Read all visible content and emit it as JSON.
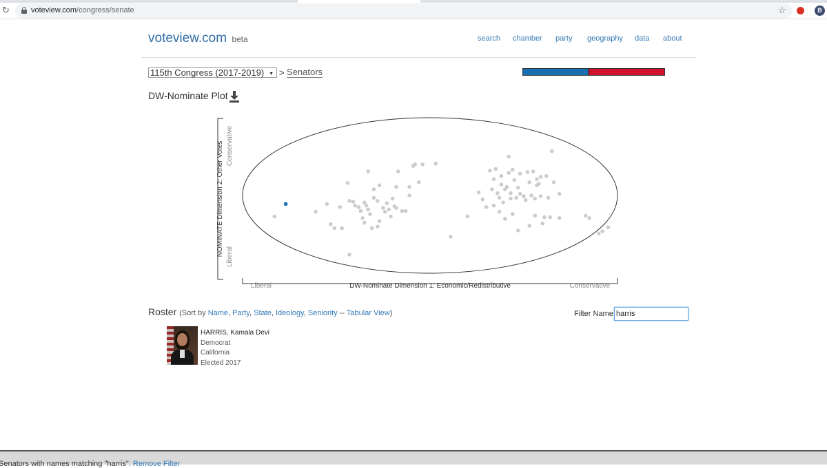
{
  "browser": {
    "url_host": "voteview.com",
    "url_path": "/congress/senate",
    "profile_initial": "B"
  },
  "site": {
    "brand": "voteview.com",
    "beta": "beta",
    "nav": [
      "search",
      "chamber",
      "party",
      "geography",
      "data",
      "about"
    ]
  },
  "congress": {
    "selected": "115th Congress (2017-2019)",
    "separator": ">",
    "chamber_link": "Senators"
  },
  "party_bar": {
    "dem_fraction": 0.46,
    "ind_fraction": 0.01,
    "rep_fraction": 0.53,
    "colors": {
      "dem": "#1a6fb0",
      "ind": "#333333",
      "rep": "#d0142c"
    }
  },
  "plot": {
    "title": "DW-Nominate Plot",
    "download_icon": "download-icon",
    "y_axis_label": "NOMINATE Dimension 2: Other Votes",
    "y_top_label": "Conservative",
    "y_bottom_label": "Liberal",
    "x_axis_label": "DW-Nominate Dimension 1: Economic/Redistributive",
    "x_left_label": "Liberal",
    "x_right_label": "Conservative"
  },
  "chart_data": {
    "type": "scatter",
    "title": "DW-Nominate Plot",
    "xlabel": "DW-Nominate Dimension 1: Economic/Redistributive",
    "ylabel": "NOMINATE Dimension 2: Other Votes",
    "xlim": [
      -1,
      1
    ],
    "ylim": [
      -1,
      1
    ],
    "highlight_color": "#1a6fb0",
    "point_color": "#cccccc",
    "highlighted": [
      {
        "x": -0.77,
        "y": -0.11
      }
    ],
    "points": [
      {
        "x": -0.83,
        "y": -0.27
      },
      {
        "x": -0.61,
        "y": -0.21
      },
      {
        "x": -0.55,
        "y": -0.11
      },
      {
        "x": -0.53,
        "y": -0.37
      },
      {
        "x": -0.51,
        "y": -0.42
      },
      {
        "x": -0.47,
        "y": -0.42
      },
      {
        "x": -0.48,
        "y": -0.15
      },
      {
        "x": -0.44,
        "y": 0.16
      },
      {
        "x": -0.43,
        "y": -0.07
      },
      {
        "x": -0.43,
        "y": -0.76
      },
      {
        "x": -0.41,
        "y": -0.08
      },
      {
        "x": -0.4,
        "y": -0.13
      },
      {
        "x": -0.38,
        "y": -0.15
      },
      {
        "x": -0.37,
        "y": -0.2
      },
      {
        "x": -0.35,
        "y": -0.09
      },
      {
        "x": -0.36,
        "y": -0.29
      },
      {
        "x": -0.35,
        "y": -0.35
      },
      {
        "x": -0.34,
        "y": -0.13
      },
      {
        "x": -0.33,
        "y": -0.18
      },
      {
        "x": -0.33,
        "y": 0.31
      },
      {
        "x": -0.32,
        "y": -0.24
      },
      {
        "x": -0.31,
        "y": -0.42
      },
      {
        "x": -0.3,
        "y": 0.08
      },
      {
        "x": -0.3,
        "y": -0.03
      },
      {
        "x": -0.28,
        "y": -0.07
      },
      {
        "x": -0.28,
        "y": -0.4
      },
      {
        "x": -0.27,
        "y": -0.33
      },
      {
        "x": -0.27,
        "y": 0.13
      },
      {
        "x": -0.25,
        "y": -0.16
      },
      {
        "x": -0.24,
        "y": -0.21
      },
      {
        "x": -0.23,
        "y": -0.1
      },
      {
        "x": -0.22,
        "y": -0.18
      },
      {
        "x": -0.21,
        "y": -0.27
      },
      {
        "x": -0.2,
        "y": -0.04
      },
      {
        "x": -0.19,
        "y": -0.14
      },
      {
        "x": -0.18,
        "y": -0.16
      },
      {
        "x": -0.18,
        "y": 0.11
      },
      {
        "x": -0.17,
        "y": 0.31
      },
      {
        "x": -0.15,
        "y": -0.2
      },
      {
        "x": -0.13,
        "y": -0.2
      },
      {
        "x": -0.11,
        "y": 0.11
      },
      {
        "x": -0.11,
        "y": 0.0
      },
      {
        "x": -0.09,
        "y": 0.38
      },
      {
        "x": -0.08,
        "y": 0.4
      },
      {
        "x": -0.06,
        "y": 0.17
      },
      {
        "x": -0.04,
        "y": 0.4
      },
      {
        "x": 0.03,
        "y": 0.41
      },
      {
        "x": 0.11,
        "y": -0.53
      },
      {
        "x": 0.2,
        "y": -0.27
      },
      {
        "x": 0.26,
        "y": 0.04
      },
      {
        "x": 0.28,
        "y": -0.05
      },
      {
        "x": 0.3,
        "y": -0.15
      },
      {
        "x": 0.32,
        "y": 0.32
      },
      {
        "x": 0.33,
        "y": 0.08
      },
      {
        "x": 0.34,
        "y": 0.21
      },
      {
        "x": 0.34,
        "y": -0.13
      },
      {
        "x": 0.35,
        "y": 0.34
      },
      {
        "x": 0.36,
        "y": 0.03
      },
      {
        "x": 0.37,
        "y": -0.03
      },
      {
        "x": 0.37,
        "y": -0.21
      },
      {
        "x": 0.38,
        "y": 0.25
      },
      {
        "x": 0.38,
        "y": 0.14
      },
      {
        "x": 0.39,
        "y": -0.09
      },
      {
        "x": 0.4,
        "y": -0.3
      },
      {
        "x": 0.4,
        "y": 0.08
      },
      {
        "x": 0.41,
        "y": 0.11
      },
      {
        "x": 0.42,
        "y": 0.29
      },
      {
        "x": 0.42,
        "y": 0.5
      },
      {
        "x": 0.43,
        "y": 0.03
      },
      {
        "x": 0.43,
        "y": -0.04
      },
      {
        "x": 0.44,
        "y": -0.24
      },
      {
        "x": 0.44,
        "y": 0.33
      },
      {
        "x": 0.45,
        "y": 0.2
      },
      {
        "x": 0.46,
        "y": -0.03
      },
      {
        "x": 0.47,
        "y": -0.45
      },
      {
        "x": 0.47,
        "y": 0.1
      },
      {
        "x": 0.48,
        "y": 0.02
      },
      {
        "x": 0.48,
        "y": 0.28
      },
      {
        "x": 0.5,
        "y": -0.01
      },
      {
        "x": 0.51,
        "y": -0.06
      },
      {
        "x": 0.52,
        "y": 0.3
      },
      {
        "x": 0.53,
        "y": 0.17
      },
      {
        "x": 0.53,
        "y": -0.39
      },
      {
        "x": 0.54,
        "y": 0.0
      },
      {
        "x": 0.55,
        "y": 0.31
      },
      {
        "x": 0.56,
        "y": -0.26
      },
      {
        "x": 0.56,
        "y": -0.04
      },
      {
        "x": 0.57,
        "y": 0.21
      },
      {
        "x": 0.57,
        "y": 0.13
      },
      {
        "x": 0.58,
        "y": 0.15
      },
      {
        "x": 0.59,
        "y": -0.01
      },
      {
        "x": 0.59,
        "y": 0.24
      },
      {
        "x": 0.6,
        "y": -0.36
      },
      {
        "x": 0.61,
        "y": -0.28
      },
      {
        "x": 0.62,
        "y": 0.25
      },
      {
        "x": 0.63,
        "y": -0.03
      },
      {
        "x": 0.64,
        "y": -0.28
      },
      {
        "x": 0.65,
        "y": 0.57
      },
      {
        "x": 0.66,
        "y": 0.17
      },
      {
        "x": 0.69,
        "y": 0.02
      },
      {
        "x": 0.69,
        "y": -0.29
      },
      {
        "x": 0.83,
        "y": -0.26
      },
      {
        "x": 0.85,
        "y": -0.29
      },
      {
        "x": 0.9,
        "y": -0.49
      },
      {
        "x": 0.92,
        "y": -0.46
      },
      {
        "x": 0.95,
        "y": -0.41
      }
    ]
  },
  "roster": {
    "title": "Roster",
    "sort_prefix": "(Sort by",
    "sort_options": [
      "Name",
      "Party",
      "State",
      "Ideology",
      "Seniority"
    ],
    "tabular_sep": "--",
    "tabular_view": "Tabular View",
    "sort_suffix": ")",
    "filter_label": "Filter Name:",
    "filter_value": "harris"
  },
  "member": {
    "name": "HARRIS, Kamala Devi",
    "party": "Democrat",
    "state": "California",
    "elected": "Elected 2017"
  },
  "footer": {
    "message": "Senators with names matching \"harris\".",
    "remove_filter": "Remove Filter"
  }
}
